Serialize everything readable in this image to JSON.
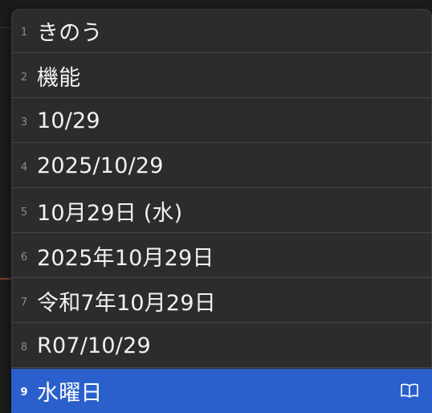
{
  "candidates": {
    "items": [
      {
        "index": "1",
        "text": "きのう"
      },
      {
        "index": "2",
        "text": "機能"
      },
      {
        "index": "3",
        "text": "10/29"
      },
      {
        "index": "4",
        "text": "2025/10/29"
      },
      {
        "index": "5",
        "text": "10月29日 (水)"
      },
      {
        "index": "6",
        "text": "2025年10月29日"
      },
      {
        "index": "7",
        "text": "令和7年10月29日"
      },
      {
        "index": "8",
        "text": "R07/10/29"
      },
      {
        "index": "9",
        "text": "水曜日"
      }
    ],
    "selected_index": 9,
    "selected_icon": "book-icon"
  },
  "colors": {
    "panel_background": "#2b2c2d",
    "selected_background": "#2a5fcc",
    "divider": "#444547",
    "text": "#f2f2f2",
    "index_text": "#8e8e8e"
  }
}
